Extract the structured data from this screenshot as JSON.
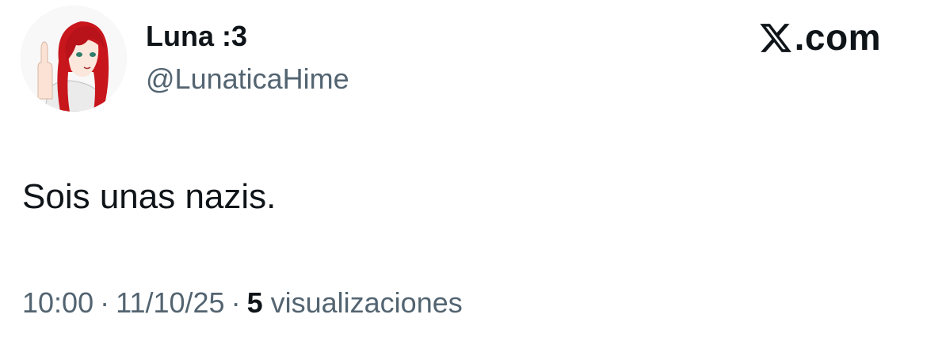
{
  "author": {
    "display_name": "Luna :3",
    "handle": "@LunaticaHime",
    "avatar_icon": "anime-avatar-icon"
  },
  "brand": {
    "label": ".com",
    "icon": "x-logo-icon"
  },
  "tweet": {
    "text": "Sois unas nazis."
  },
  "meta": {
    "time": "10:00",
    "separator": "·",
    "date": "11/10/25",
    "views_count": "5",
    "views_label": "visualizaciones"
  },
  "colors": {
    "text_primary": "#0f1419",
    "text_secondary": "#536471",
    "background": "#ffffff",
    "avatar_hair": "#c8161d"
  }
}
